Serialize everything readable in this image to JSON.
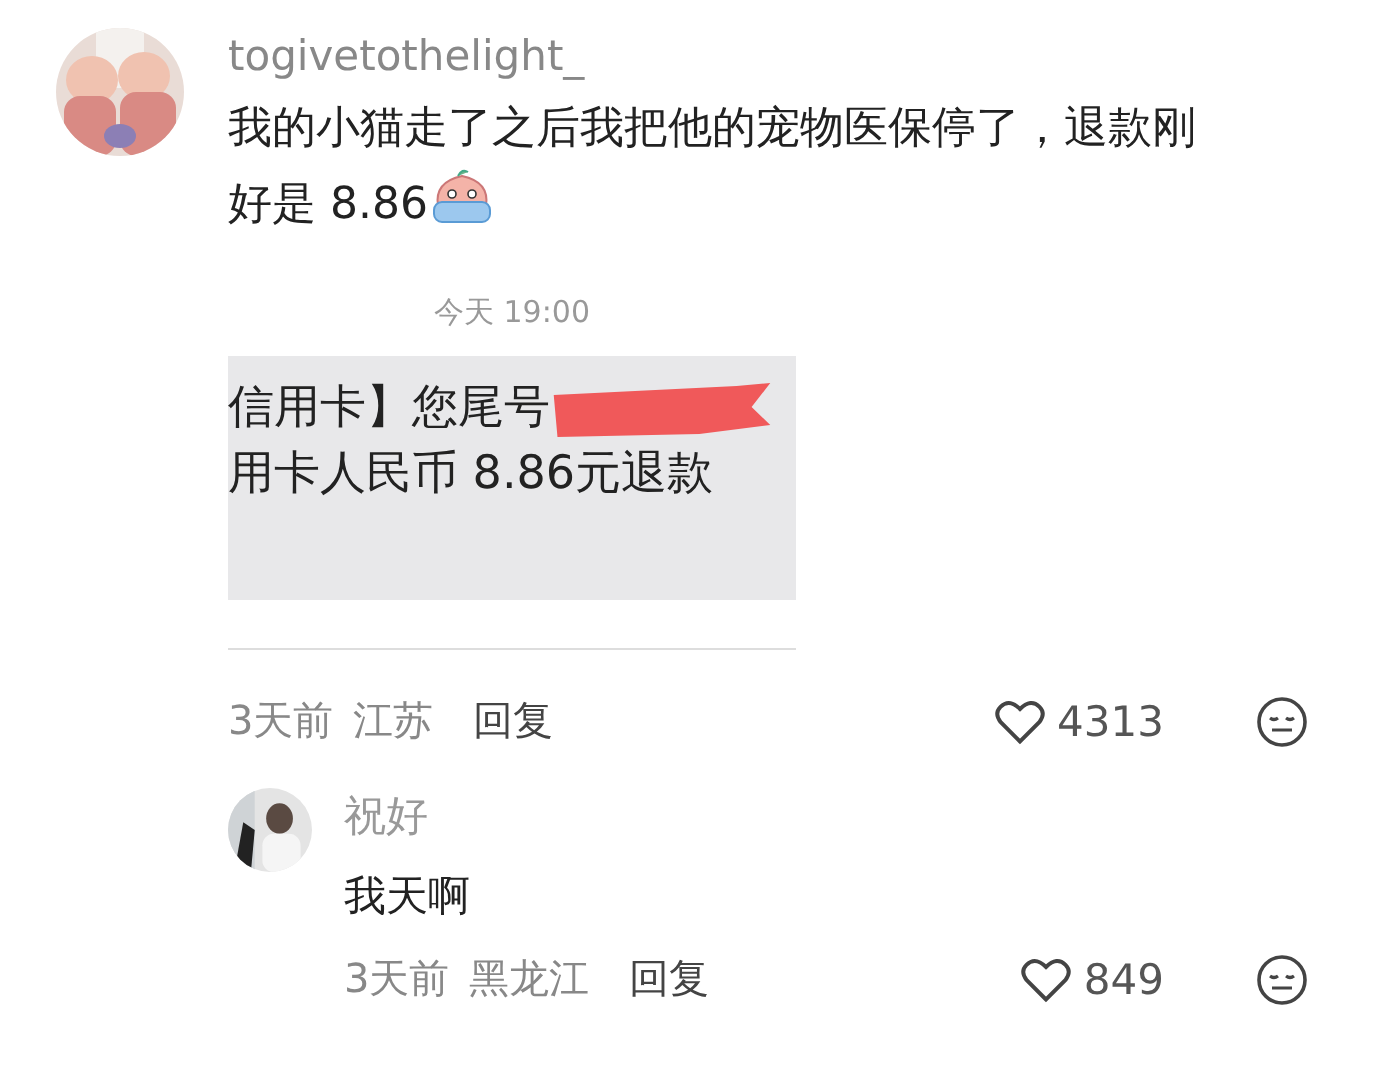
{
  "comment": {
    "username": "togivetothelight_",
    "text_lines": [
      "我的小猫走了之后我把他的宠物医保停了，退款刚",
      "好是 8.86"
    ],
    "attachment": {
      "timestamp": "今天 19:00",
      "lines": [
        "信用卡】您尾号",
        "用卡人民币 8.86元退款"
      ]
    },
    "time": "3天前",
    "location": "江苏",
    "reply_label": "回复",
    "likes": "4313"
  },
  "replies": [
    {
      "username": "祝好",
      "text": "我天啊",
      "time": "3天前",
      "location": "黑龙江",
      "reply_label": "回复",
      "likes": "849"
    }
  ]
}
